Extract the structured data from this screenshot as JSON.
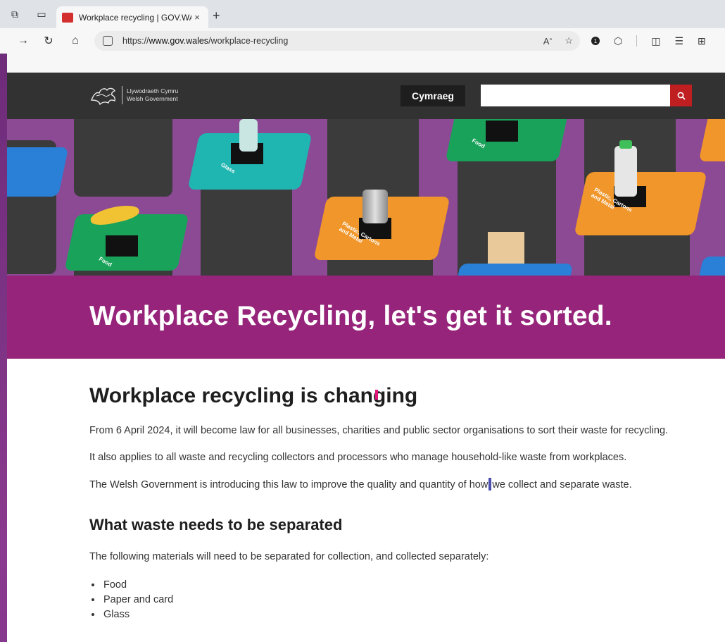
{
  "browser": {
    "tab_title": "Workplace recycling | GOV.WALE",
    "url_prefix": "https://",
    "url_domain": "www.gov.wales",
    "url_path": "/workplace-recycling",
    "new_tab_glyph": "+",
    "close_glyph": "×",
    "extensions_badge": "1"
  },
  "header": {
    "logo_line1": "Llywodraeth Cymru",
    "logo_line2": "Welsh Government",
    "language_button": "Cymraeg",
    "search_placeholder": ""
  },
  "hero": {
    "labels": {
      "glass": "Glass",
      "food_top": "Food",
      "food_bottom": "Food",
      "plastic_left": "Plastic, Cartons and Metal",
      "plastic_right": "Plastic, Cartons and Metal"
    },
    "colors": {
      "background": "#8c4a95",
      "teal": "#1fb5b0",
      "green": "#19a35a",
      "orange": "#f0962a",
      "blue": "#2a7fd6"
    }
  },
  "banner": {
    "title": "Workplace Recycling, let's get it sorted.",
    "color": "#96247a"
  },
  "main": {
    "heading": "Workplace recycling is changing",
    "para1": "From 6 April 2024, it will become law for all businesses, charities and public sector organisations to sort their waste for recycling.",
    "para2": "It also applies to all waste and recycling collectors and processors who manage household-like waste from workplaces.",
    "para3_before": "The Welsh Government is introducing this law to improve the quality and quantity of how",
    "para3_after": "we collect and separate waste.",
    "subheading": "What waste needs to be separated",
    "para4": "The following materials will need to be separated for collection, and collected separately:",
    "list": [
      "Food",
      "Paper and card",
      "Glass"
    ]
  }
}
